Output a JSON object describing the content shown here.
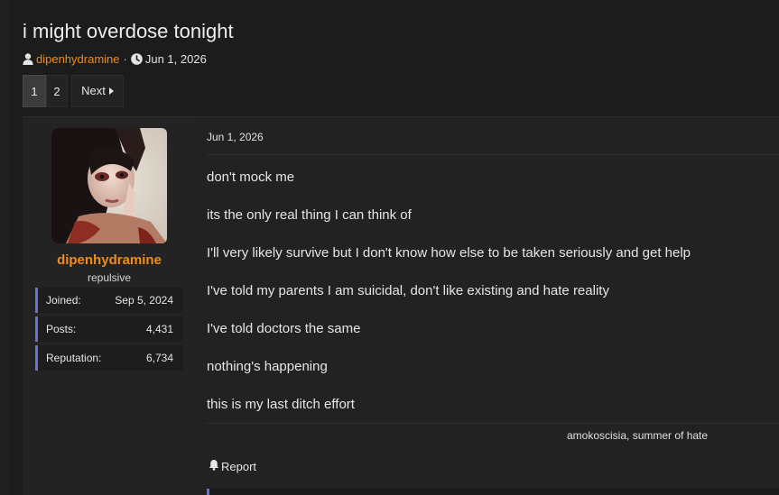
{
  "thread": {
    "title": "i might overdose tonight",
    "author": "dipenhydramine",
    "separator": "·",
    "date": "Jun 1, 2026"
  },
  "pagination": {
    "pages": [
      "1",
      "2"
    ],
    "current": "1",
    "next_label": "Next"
  },
  "post": {
    "user": {
      "name": "dipenhydramine",
      "title": "repulsive",
      "stats": [
        {
          "label": "Joined:",
          "value": "Sep 5, 2024"
        },
        {
          "label": "Posts:",
          "value": "4,431"
        },
        {
          "label": "Reputation:",
          "value": "6,734"
        }
      ]
    },
    "date": "Jun 1, 2026",
    "lines": [
      "don't mock me",
      "its the only real thing I can think of",
      "I'll very likely survive but I don't know how else to be taken seriously and get help",
      "I've told my parents I am suicidal, don't like existing and hate reality",
      "I've told doctors the same",
      "nothing's happening",
      "this is my last ditch effort"
    ],
    "signature": "amokoscisia, summer of hate",
    "report_label": "Report"
  },
  "colors": {
    "accent": "#f08c1e",
    "stat_border": "#6a72c9",
    "background": "#1c1c1c"
  },
  "icons": {
    "author": "user-icon",
    "date": "clock-icon",
    "next": "caret-right-icon",
    "report": "bell-icon"
  }
}
